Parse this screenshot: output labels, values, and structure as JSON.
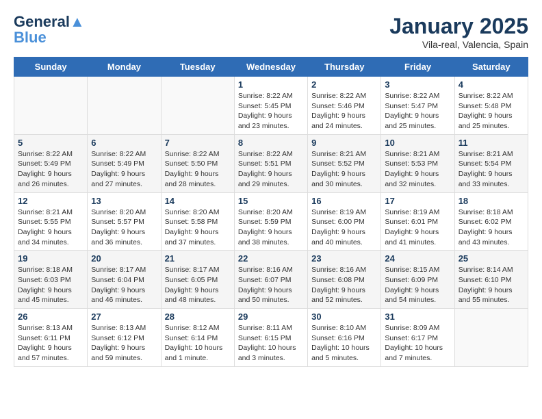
{
  "header": {
    "logo_general": "General",
    "logo_blue": "Blue",
    "title": "January 2025",
    "subtitle": "Vila-real, Valencia, Spain"
  },
  "days_of_week": [
    "Sunday",
    "Monday",
    "Tuesday",
    "Wednesday",
    "Thursday",
    "Friday",
    "Saturday"
  ],
  "weeks": [
    [
      {
        "num": "",
        "info": ""
      },
      {
        "num": "",
        "info": ""
      },
      {
        "num": "",
        "info": ""
      },
      {
        "num": "1",
        "info": "Sunrise: 8:22 AM\nSunset: 5:45 PM\nDaylight: 9 hours and 23 minutes."
      },
      {
        "num": "2",
        "info": "Sunrise: 8:22 AM\nSunset: 5:46 PM\nDaylight: 9 hours and 24 minutes."
      },
      {
        "num": "3",
        "info": "Sunrise: 8:22 AM\nSunset: 5:47 PM\nDaylight: 9 hours and 25 minutes."
      },
      {
        "num": "4",
        "info": "Sunrise: 8:22 AM\nSunset: 5:48 PM\nDaylight: 9 hours and 25 minutes."
      }
    ],
    [
      {
        "num": "5",
        "info": "Sunrise: 8:22 AM\nSunset: 5:49 PM\nDaylight: 9 hours and 26 minutes."
      },
      {
        "num": "6",
        "info": "Sunrise: 8:22 AM\nSunset: 5:49 PM\nDaylight: 9 hours and 27 minutes."
      },
      {
        "num": "7",
        "info": "Sunrise: 8:22 AM\nSunset: 5:50 PM\nDaylight: 9 hours and 28 minutes."
      },
      {
        "num": "8",
        "info": "Sunrise: 8:22 AM\nSunset: 5:51 PM\nDaylight: 9 hours and 29 minutes."
      },
      {
        "num": "9",
        "info": "Sunrise: 8:21 AM\nSunset: 5:52 PM\nDaylight: 9 hours and 30 minutes."
      },
      {
        "num": "10",
        "info": "Sunrise: 8:21 AM\nSunset: 5:53 PM\nDaylight: 9 hours and 32 minutes."
      },
      {
        "num": "11",
        "info": "Sunrise: 8:21 AM\nSunset: 5:54 PM\nDaylight: 9 hours and 33 minutes."
      }
    ],
    [
      {
        "num": "12",
        "info": "Sunrise: 8:21 AM\nSunset: 5:55 PM\nDaylight: 9 hours and 34 minutes."
      },
      {
        "num": "13",
        "info": "Sunrise: 8:20 AM\nSunset: 5:57 PM\nDaylight: 9 hours and 36 minutes."
      },
      {
        "num": "14",
        "info": "Sunrise: 8:20 AM\nSunset: 5:58 PM\nDaylight: 9 hours and 37 minutes."
      },
      {
        "num": "15",
        "info": "Sunrise: 8:20 AM\nSunset: 5:59 PM\nDaylight: 9 hours and 38 minutes."
      },
      {
        "num": "16",
        "info": "Sunrise: 8:19 AM\nSunset: 6:00 PM\nDaylight: 9 hours and 40 minutes."
      },
      {
        "num": "17",
        "info": "Sunrise: 8:19 AM\nSunset: 6:01 PM\nDaylight: 9 hours and 41 minutes."
      },
      {
        "num": "18",
        "info": "Sunrise: 8:18 AM\nSunset: 6:02 PM\nDaylight: 9 hours and 43 minutes."
      }
    ],
    [
      {
        "num": "19",
        "info": "Sunrise: 8:18 AM\nSunset: 6:03 PM\nDaylight: 9 hours and 45 minutes."
      },
      {
        "num": "20",
        "info": "Sunrise: 8:17 AM\nSunset: 6:04 PM\nDaylight: 9 hours and 46 minutes."
      },
      {
        "num": "21",
        "info": "Sunrise: 8:17 AM\nSunset: 6:05 PM\nDaylight: 9 hours and 48 minutes."
      },
      {
        "num": "22",
        "info": "Sunrise: 8:16 AM\nSunset: 6:07 PM\nDaylight: 9 hours and 50 minutes."
      },
      {
        "num": "23",
        "info": "Sunrise: 8:16 AM\nSunset: 6:08 PM\nDaylight: 9 hours and 52 minutes."
      },
      {
        "num": "24",
        "info": "Sunrise: 8:15 AM\nSunset: 6:09 PM\nDaylight: 9 hours and 54 minutes."
      },
      {
        "num": "25",
        "info": "Sunrise: 8:14 AM\nSunset: 6:10 PM\nDaylight: 9 hours and 55 minutes."
      }
    ],
    [
      {
        "num": "26",
        "info": "Sunrise: 8:13 AM\nSunset: 6:11 PM\nDaylight: 9 hours and 57 minutes."
      },
      {
        "num": "27",
        "info": "Sunrise: 8:13 AM\nSunset: 6:12 PM\nDaylight: 9 hours and 59 minutes."
      },
      {
        "num": "28",
        "info": "Sunrise: 8:12 AM\nSunset: 6:14 PM\nDaylight: 10 hours and 1 minute."
      },
      {
        "num": "29",
        "info": "Sunrise: 8:11 AM\nSunset: 6:15 PM\nDaylight: 10 hours and 3 minutes."
      },
      {
        "num": "30",
        "info": "Sunrise: 8:10 AM\nSunset: 6:16 PM\nDaylight: 10 hours and 5 minutes."
      },
      {
        "num": "31",
        "info": "Sunrise: 8:09 AM\nSunset: 6:17 PM\nDaylight: 10 hours and 7 minutes."
      },
      {
        "num": "",
        "info": ""
      }
    ]
  ]
}
